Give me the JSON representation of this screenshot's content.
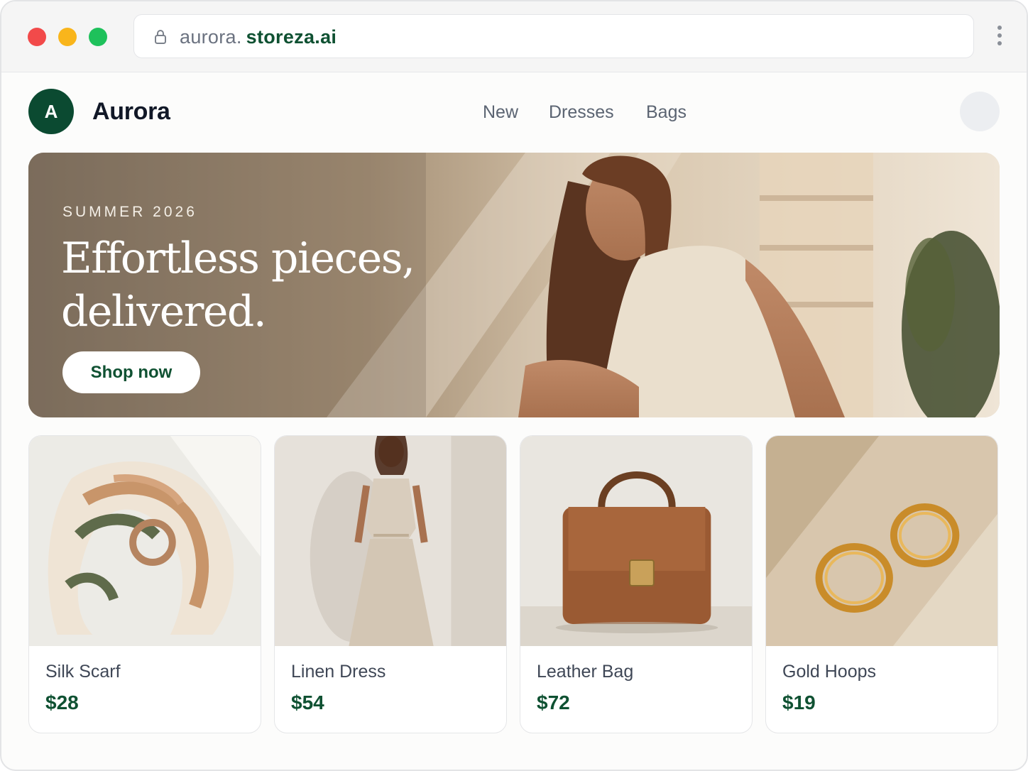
{
  "browser": {
    "url_subdomain": "aurora.",
    "url_domain": "storeza.ai"
  },
  "header": {
    "logo_letter": "A",
    "brand": "Aurora",
    "nav": [
      "New",
      "Dresses",
      "Bags"
    ]
  },
  "hero": {
    "eyebrow": "SUMMER 2026",
    "title": "Effortless pieces, delivered.",
    "cta": "Shop now"
  },
  "products": [
    {
      "name": "Silk Scarf",
      "price": "$28",
      "icon": "scarf-image"
    },
    {
      "name": "Linen Dress",
      "price": "$54",
      "icon": "dress-image"
    },
    {
      "name": "Leather Bag",
      "price": "$72",
      "icon": "bag-image"
    },
    {
      "name": "Gold Hoops",
      "price": "$19",
      "icon": "earrings-image"
    }
  ],
  "colors": {
    "brand_green": "#0b4a31",
    "price_green": "#0f5132",
    "hero_tone": "#9d8b75"
  }
}
